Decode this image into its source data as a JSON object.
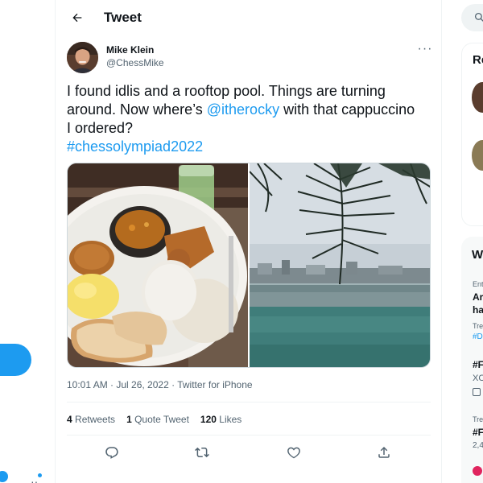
{
  "header": {
    "title": "Tweet"
  },
  "tweet": {
    "author_name": "Mike Klein",
    "author_handle": "@ChessMike",
    "text": {
      "line1": "I found idlis and a rooftop pool. Things are turning",
      "line2": "around. Now where’s ",
      "mention": "@itherocky",
      "line2_rest": " with that cappuccino",
      "line3": "I ordered?",
      "hashtag": "#chessolympiad2022"
    },
    "timestamp": "10:01 AM · Jul 26, 2022 · Twitter for iPhone",
    "stats": {
      "retweets_count": "4",
      "retweets_label": "Retweets",
      "quotes_count": "1",
      "quotes_label": "Quote Tweet",
      "likes_count": "120",
      "likes_label": "Likes"
    }
  },
  "right_sidebar": {
    "card1_title_fragment": "Re",
    "card2_title_fragment": "W",
    "trend1_meta_fragment": "Ent",
    "trend1_line1_fragment": "Ar",
    "trend1_line2_fragment": "ha",
    "trend1_sub_fragment": "Tre",
    "trend1_tag_fragment": "#D",
    "trend2_title_fragment": "#F",
    "trend2_sub_fragment": "XC",
    "trend3_meta_fragment": "Tre",
    "trend3_title_fragment": "#F",
    "trend3_count_fragment": "2,4"
  },
  "colors": {
    "accent": "#1d9bf0",
    "text": "#0f1419",
    "muted": "#536471",
    "border": "#eff3f4"
  }
}
